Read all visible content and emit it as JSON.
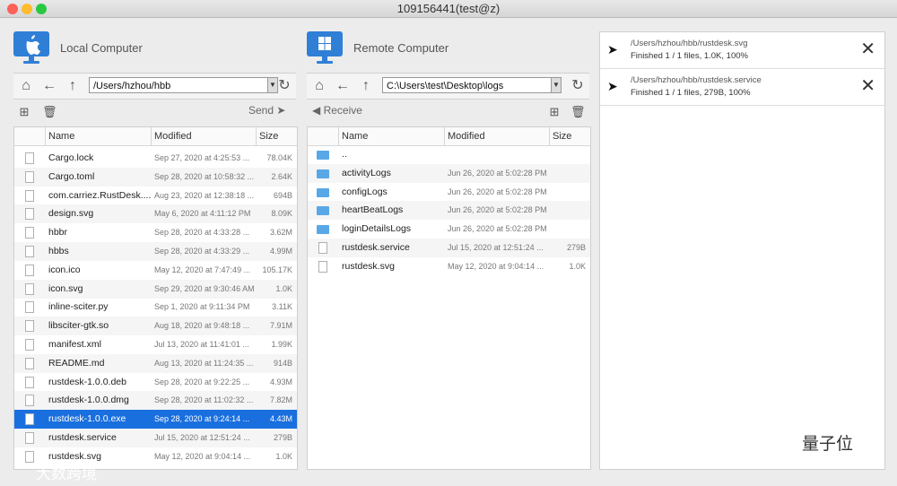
{
  "window": {
    "title": "109156441(test@z)"
  },
  "local": {
    "label": "Local Computer",
    "path": "/Users/hzhou/hbb",
    "action": "Send",
    "columns": [
      "Name",
      "Modified",
      "Size"
    ],
    "files": [
      {
        "name": "Cargo.lock",
        "modified": "Sep 27, 2020 at 4:25:53 ...",
        "size": "78.04K",
        "icon": "file-icon"
      },
      {
        "name": "Cargo.toml",
        "modified": "Sep 28, 2020 at 10:58:32 ...",
        "size": "2.64K",
        "icon": "file-icon"
      },
      {
        "name": "com.carriez.RustDesk....",
        "modified": "Aug 23, 2020 at 12:38:18 ...",
        "size": "694B",
        "icon": "file-icon"
      },
      {
        "name": "design.svg",
        "modified": "May 6, 2020 at 4:11:12 PM",
        "size": "8.09K",
        "icon": "file-icon"
      },
      {
        "name": "hbbr",
        "modified": "Sep 28, 2020 at 4:33:28 ...",
        "size": "3.62M",
        "icon": "file-icon"
      },
      {
        "name": "hbbs",
        "modified": "Sep 28, 2020 at 4:33:29 ...",
        "size": "4.99M",
        "icon": "file-icon"
      },
      {
        "name": "icon.ico",
        "modified": "May 12, 2020 at 7:47:49 ...",
        "size": "105.17K",
        "icon": "image-file-icon"
      },
      {
        "name": "icon.svg",
        "modified": "Sep 29, 2020 at 9:30:46 AM",
        "size": "1.0K",
        "icon": "file-icon"
      },
      {
        "name": "inline-sciter.py",
        "modified": "Sep 1, 2020 at 9:11:34 PM",
        "size": "3.11K",
        "icon": "python-file-icon"
      },
      {
        "name": "libsciter-gtk.so",
        "modified": "Aug 18, 2020 at 9:48:18 ...",
        "size": "7.91M",
        "icon": "file-icon"
      },
      {
        "name": "manifest.xml",
        "modified": "Jul 13, 2020 at 11:41:01 ...",
        "size": "1.99K",
        "icon": "rss-file-icon"
      },
      {
        "name": "README.md",
        "modified": "Aug 13, 2020 at 11:24:35 ...",
        "size": "914B",
        "icon": "markdown-file-icon"
      },
      {
        "name": "rustdesk-1.0.0.deb",
        "modified": "Sep 28, 2020 at 9:22:25 ...",
        "size": "4.93M",
        "icon": "file-icon"
      },
      {
        "name": "rustdesk-1.0.0.dmg",
        "modified": "Sep 28, 2020 at 11:02:32 ...",
        "size": "7.82M",
        "icon": "disk-image-icon"
      },
      {
        "name": "rustdesk-1.0.0.exe",
        "modified": "Sep 28, 2020 at 9:24:14 ...",
        "size": "4.43M",
        "icon": "file-icon",
        "selected": true
      },
      {
        "name": "rustdesk.service",
        "modified": "Jul 15, 2020 at 12:51:24 ...",
        "size": "279B",
        "icon": "script-file-icon"
      },
      {
        "name": "rustdesk.svg",
        "modified": "May 12, 2020 at 9:04:14 ...",
        "size": "1.0K",
        "icon": "file-icon"
      }
    ]
  },
  "remote": {
    "label": "Remote Computer",
    "path": "C:\\Users\\test\\Desktop\\logs",
    "action": "Receive",
    "columns": [
      "Name",
      "Modified",
      "Size"
    ],
    "files": [
      {
        "name": "..",
        "modified": "",
        "size": "",
        "icon": "folder-icon"
      },
      {
        "name": "activityLogs",
        "modified": "Jun 26, 2020 at 5:02:28 PM",
        "size": "",
        "icon": "folder-icon"
      },
      {
        "name": "configLogs",
        "modified": "Jun 26, 2020 at 5:02:28 PM",
        "size": "",
        "icon": "folder-icon"
      },
      {
        "name": "heartBeatLogs",
        "modified": "Jun 26, 2020 at 5:02:28 PM",
        "size": "",
        "icon": "folder-icon"
      },
      {
        "name": "loginDetailsLogs",
        "modified": "Jun 26, 2020 at 5:02:28 PM",
        "size": "",
        "icon": "folder-icon"
      },
      {
        "name": "rustdesk.service",
        "modified": "Jul 15, 2020 at 12:51:24 ...",
        "size": "279B",
        "icon": "script-file-icon"
      },
      {
        "name": "rustdesk.svg",
        "modified": "May 12, 2020 at 9:04:14 ...",
        "size": "1.0K",
        "icon": "file-icon"
      }
    ]
  },
  "jobs": [
    {
      "path": "/Users/hzhou/hbb/rustdesk.svg",
      "status": "Finished 1 / 1 files, 1.0K, 100%"
    },
    {
      "path": "/Users/hzhou/hbb/rustdesk.service",
      "status": "Finished 1 / 1 files, 279B, 100%"
    }
  ],
  "watermarks": {
    "left": "大数跨境",
    "right": "量子位"
  },
  "colors": {
    "accent": "#2f7fd6",
    "selection": "#1a6fdf",
    "folder": "#58a8e8"
  }
}
